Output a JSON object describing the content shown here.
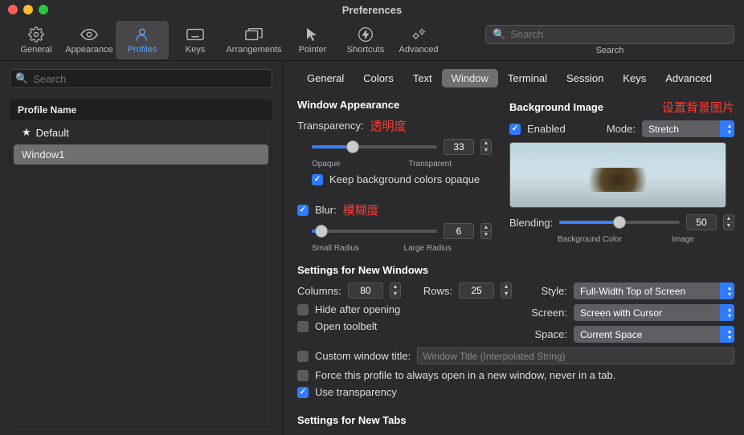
{
  "title": "Preferences",
  "toolbar": {
    "items": [
      {
        "id": "general",
        "label": "General"
      },
      {
        "id": "appearance",
        "label": "Appearance"
      },
      {
        "id": "profiles",
        "label": "Profiles"
      },
      {
        "id": "keys",
        "label": "Keys"
      },
      {
        "id": "arrangements",
        "label": "Arrangements"
      },
      {
        "id": "pointer",
        "label": "Pointer"
      },
      {
        "id": "shortcuts",
        "label": "Shortcuts"
      },
      {
        "id": "advanced",
        "label": "Advanced"
      }
    ],
    "search_placeholder": "Search",
    "search_label": "Search"
  },
  "sidebar": {
    "search_placeholder": "Search",
    "header": "Profile Name",
    "rows": [
      {
        "label": "Default",
        "starred": true
      },
      {
        "label": "Window1",
        "starred": false
      }
    ]
  },
  "tabs": [
    "General",
    "Colors",
    "Text",
    "Window",
    "Terminal",
    "Session",
    "Keys",
    "Advanced"
  ],
  "appearance": {
    "heading": "Window Appearance",
    "transparency_label": "Transparency:",
    "transparency_ann": "透明度",
    "transparency_value": "33",
    "opaque": "Opaque",
    "transparent": "Transparent",
    "keep_bg": "Keep background colors opaque",
    "blur_label": "Blur:",
    "blur_ann": "模糊度",
    "blur_value": "6",
    "small_radius": "Small Radius",
    "large_radius": "Large Radius"
  },
  "bg": {
    "heading": "Background Image",
    "ann": "设置背景图片",
    "enabled": "Enabled",
    "mode_label": "Mode:",
    "mode": "Stretch",
    "blending_label": "Blending:",
    "blending_value": "50",
    "bgcolor": "Background Color",
    "image": "Image"
  },
  "newwin": {
    "heading": "Settings for New Windows",
    "columns_label": "Columns:",
    "columns": "80",
    "rows_label": "Rows:",
    "rows": "25",
    "hide": "Hide after opening",
    "toolbelt": "Open toolbelt",
    "custom_title": "Custom window title:",
    "custom_ph": "Window Title (Interpolated String)",
    "force": "Force this profile to always open in a new window, never in a tab.",
    "use_trans": "Use transparency",
    "style_label": "Style:",
    "style": "Full-Width Top of Screen",
    "screen_label": "Screen:",
    "screen": "Screen with Cursor",
    "space_label": "Space:",
    "space": "Current Space"
  },
  "newtabs": {
    "heading": "Settings for New Tabs"
  }
}
